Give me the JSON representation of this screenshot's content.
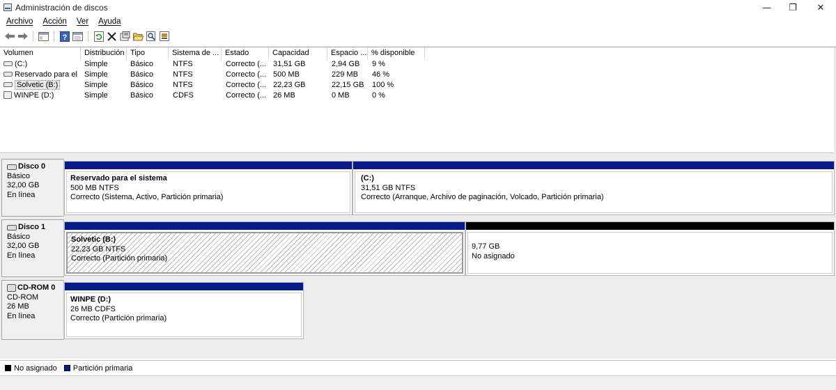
{
  "window": {
    "title": "Administración de discos"
  },
  "window_controls": {
    "minimize": "—",
    "maximize": "❐",
    "close": "✕"
  },
  "menu": [
    "Archivo",
    "Acción",
    "Ver",
    "Ayuda"
  ],
  "toolbar_icons": [
    "back-arrow-icon",
    "forward-arrow-icon",
    "panel-icon",
    "help-icon",
    "list-view-icon",
    "refresh-icon",
    "delete-icon",
    "properties-icon",
    "open-folder-icon",
    "search-icon",
    "settings-icon"
  ],
  "volumes": {
    "headers": [
      "Volumen",
      "Distribución",
      "Tipo",
      "Sistema de ...",
      "Estado",
      "Capacidad",
      "Espacio ...",
      "% disponible"
    ],
    "rows": [
      {
        "icon": "drive-icon",
        "cells": [
          "(C:)",
          "Simple",
          "Básico",
          "NTFS",
          "Correcto (...",
          "31,51 GB",
          "2,94 GB",
          "9 %"
        ]
      },
      {
        "icon": "drive-icon",
        "cells": [
          "Reservado para el ...",
          "Simple",
          "Básico",
          "NTFS",
          "Correcto (...",
          "500 MB",
          "229 MB",
          "46 %"
        ]
      },
      {
        "icon": "drive-icon",
        "cells": [
          "Solvetic (B:)",
          "Simple",
          "Básico",
          "NTFS",
          "Correcto (...",
          "22,23 GB",
          "22,15 GB",
          "100 %"
        ]
      },
      {
        "icon": "cd-icon",
        "cells": [
          "WINPE (D:)",
          "Simple",
          "Básico",
          "CDFS",
          "Correcto (...",
          "26 MB",
          "0 MB",
          "0 %"
        ]
      }
    ]
  },
  "disks": [
    {
      "name": "Disco 0",
      "type": "Básico",
      "size": "32,00 GB",
      "status": "En línea",
      "partitions": [
        {
          "name": "Reservado para el sistema",
          "size": "500 MB NTFS",
          "status": "Correcto (Sistema, Activo, Partición primaria)",
          "kind": "primary"
        },
        {
          "name": "(C:)",
          "size": "31,51 GB NTFS",
          "status": "Correcto (Arranque, Archivo de paginación, Volcado, Partición primaria)",
          "kind": "primary"
        }
      ]
    },
    {
      "name": "Disco 1",
      "type": "Básico",
      "size": "32,00 GB",
      "status": "En línea",
      "partitions": [
        {
          "name": "Solvetic  (B:)",
          "size": "22,23 GB NTFS",
          "status": "Correcto (Partición primaria)",
          "kind": "primary"
        },
        {
          "name": "",
          "size": "9,77 GB",
          "status": "No asignado",
          "kind": "unallocated"
        }
      ]
    },
    {
      "name": "CD-ROM 0",
      "type": "CD-ROM",
      "size": "26 MB",
      "status": "En línea",
      "partitions": [
        {
          "name": "WINPE  (D:)",
          "size": "26 MB CDFS",
          "status": "Correcto (Partición primaria)",
          "kind": "primary"
        }
      ]
    }
  ],
  "legend": [
    {
      "label": "No asignado",
      "color": "#000000"
    },
    {
      "label": "Partición primaria",
      "color": "#0a1a8c"
    }
  ],
  "colors": {
    "primary_bar": "#0a1a8c",
    "unallocated_bar": "#000000"
  }
}
